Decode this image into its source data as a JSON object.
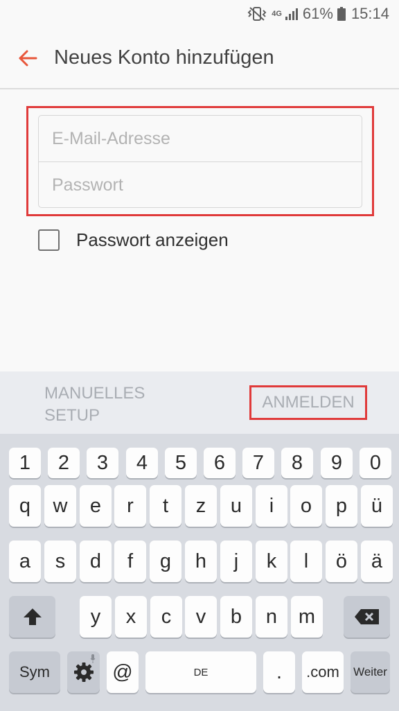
{
  "status_bar": {
    "network_type": "4G",
    "battery_level": "61%",
    "time": "15:14",
    "icons": [
      "vibrate-icon",
      "network-4g-icon",
      "signal-icon",
      "battery-icon"
    ]
  },
  "header": {
    "title": "Neues Konto hinzufügen",
    "back_icon": "arrow-left-icon"
  },
  "form": {
    "email": {
      "value": "",
      "placeholder": "E-Mail-Adresse"
    },
    "password": {
      "value": "",
      "placeholder": "Passwort"
    },
    "show_password": {
      "label": "Passwort anzeigen",
      "checked": false
    }
  },
  "actions": {
    "manual_setup_label": "MANUELLES SETUP",
    "login_label": "ANMELDEN"
  },
  "keyboard": {
    "rows": [
      [
        "1",
        "2",
        "3",
        "4",
        "5",
        "6",
        "7",
        "8",
        "9",
        "0"
      ],
      [
        "q",
        "w",
        "e",
        "r",
        "t",
        "z",
        "u",
        "i",
        "o",
        "p",
        "ü"
      ],
      [
        "a",
        "s",
        "d",
        "f",
        "g",
        "h",
        "j",
        "k",
        "l",
        "ö",
        "ä"
      ],
      [
        "y",
        "x",
        "c",
        "v",
        "b",
        "n",
        "m"
      ]
    ],
    "sym_label": "Sym",
    "at_label": "@",
    "space_label": "DE",
    "period_label": ".",
    "dotcom_label": ".com",
    "next_label": "Weiter",
    "icons": [
      "shift-icon",
      "backspace-icon",
      "settings-icon",
      "microphone-icon"
    ]
  },
  "colors": {
    "accent": "#e8563a",
    "highlight": "#e03a3a",
    "keyboard_bg": "#d8dbe1",
    "action_bar_bg": "#eaecf0"
  }
}
